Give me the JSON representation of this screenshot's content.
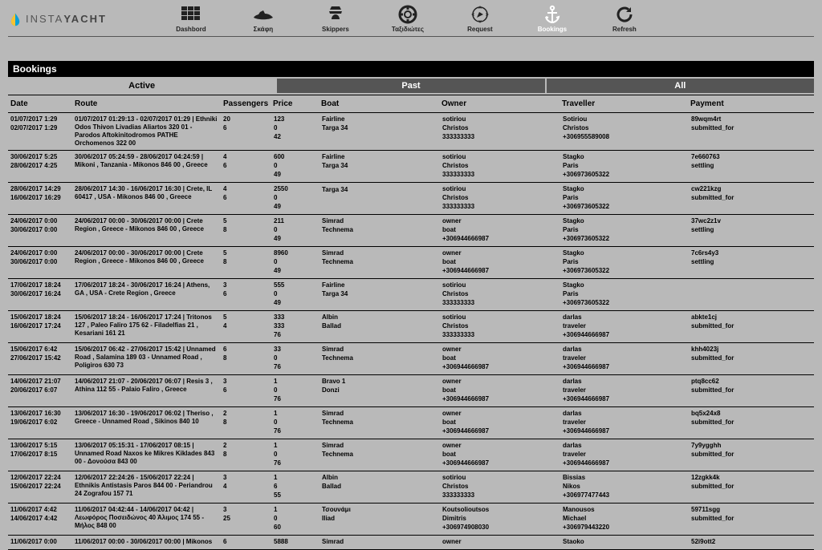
{
  "brand": {
    "name_a": "INSTA",
    "name_b": "YACHT"
  },
  "nav": {
    "dashboard": "Dashbord",
    "skafi": "Σκάφη",
    "skippers": "Skippers",
    "taxi": "Ταξιδιώτες",
    "request": "Request",
    "bookings": "Bookings",
    "refresh": "Refresh"
  },
  "title": "Bookings",
  "filters": {
    "active": "Active",
    "past": "Past",
    "all": "All"
  },
  "headers": {
    "date": "Date",
    "route": "Route",
    "passengers": "Passengers",
    "price": "Price",
    "boat": "Boat",
    "owner": "Owner",
    "traveller": "Traveller",
    "payment": "Payment"
  },
  "rows": [
    {
      "date": [
        "01/07/2017 1:29",
        "02/07/2017 1:29"
      ],
      "route": "01/07/2017 01:29:13 - 02/07/2017 01:29 |  Ethniki Odos Thivon Livadias Aliartos 320 01 - Parodos Aftokinitodromos PATHE Orchomenos 322 00",
      "pax": [
        "20",
        "6"
      ],
      "price": [
        "123",
        "0",
        "42"
      ],
      "boat": [
        "Fairline",
        "Targa 34",
        ""
      ],
      "owner": [
        "sotiriou",
        "Christos",
        "333333333"
      ],
      "trav": [
        "Sotiriou",
        "Christos",
        "+306955589008"
      ],
      "pay": [
        "89wqm4rt",
        "submitted_for",
        ""
      ]
    },
    {
      "date": [
        "30/06/2017 5:25",
        "28/06/2017 4:25"
      ],
      "route": "30/06/2017 05:24:59 - 28/06/2017 04:24:59 | Mikoni , Tanzania - Mikonos 846 00 , Greece",
      "pax": [
        "4",
        "6"
      ],
      "price": [
        "600",
        "0",
        "49"
      ],
      "boat": [
        "Fairline",
        "Targa 34",
        ""
      ],
      "owner": [
        "sotiriou",
        "Christos",
        "333333333"
      ],
      "trav": [
        "Stagko",
        "Paris",
        "+306973605322"
      ],
      "pay": [
        "7e660763",
        "settling",
        ""
      ]
    },
    {
      "date": [
        "28/06/2017 14:29",
        "16/06/2017 16:29"
      ],
      "route": "28/06/2017 14:30 - 16/06/2017 16:30 | Crete, IL 60417 , USA - Mikonos 846 00 , Greece",
      "pax": [
        "4",
        "6"
      ],
      "price": [
        "2550",
        "0",
        "49"
      ],
      "boat": [
        "",
        "Targa 34",
        ""
      ],
      "owner": [
        "sotiriou",
        "Christos",
        "333333333"
      ],
      "trav": [
        "Stagko",
        "Paris",
        "+306973605322"
      ],
      "pay": [
        "cw221kzg",
        "submitted_for",
        ""
      ]
    },
    {
      "date": [
        "24/06/2017 0:00",
        "30/06/2017 0:00"
      ],
      "route": "24/06/2017 00:00 - 30/06/2017 00:00 | Crete Region , Greece - Mikonos 846 00 , Greece",
      "pax": [
        "5",
        "8"
      ],
      "price": [
        "211",
        "0",
        "49"
      ],
      "boat": [
        "Simrad",
        "Technema",
        ""
      ],
      "owner": [
        "owner",
        "boat",
        "+306944666987"
      ],
      "trav": [
        "Stagko",
        "Paris",
        "+306973605322"
      ],
      "pay": [
        "37wc2z1v",
        "settling",
        ""
      ]
    },
    {
      "date": [
        "24/06/2017 0:00",
        "30/06/2017 0:00"
      ],
      "route": "24/06/2017 00:00 - 30/06/2017 00:00 | Crete Region , Greece - Mikonos 846 00 , Greece",
      "pax": [
        "5",
        "8"
      ],
      "price": [
        "8960",
        "0",
        "49"
      ],
      "boat": [
        "Simrad",
        "Technema",
        ""
      ],
      "owner": [
        "owner",
        "boat",
        "+306944666987"
      ],
      "trav": [
        "Stagko",
        "Paris",
        "+306973605322"
      ],
      "pay": [
        "7c6rs4y3",
        "settling",
        ""
      ]
    },
    {
      "date": [
        "17/06/2017 18:24",
        "30/06/2017 16:24"
      ],
      "route": "17/06/2017 18:24 - 30/06/2017 16:24 | Athens, GA , USA - Crete Region , Greece",
      "pax": [
        "3",
        "6"
      ],
      "price": [
        "555",
        "0",
        "49"
      ],
      "boat": [
        "Fairline",
        "Targa 34",
        ""
      ],
      "owner": [
        "sotiriou",
        "Christos",
        "333333333"
      ],
      "trav": [
        "Stagko",
        "Paris",
        "+306973605322"
      ],
      "pay": [
        "",
        "",
        ""
      ]
    },
    {
      "date": [
        "15/06/2017 18:24",
        "16/06/2017 17:24"
      ],
      "route": "15/06/2017 18:24 - 16/06/2017 17:24 | Tritonos 127 , Paleo Faliro 175 62 - Filadelfias 21 , Kesariani 161 21",
      "pax": [
        "5",
        "4"
      ],
      "price": [
        "333",
        "333",
        "76"
      ],
      "boat": [
        "Albin",
        "Ballad",
        ""
      ],
      "owner": [
        "sotiriou",
        "Christos",
        "333333333"
      ],
      "trav": [
        "darlas",
        "traveler",
        "+306944666987"
      ],
      "pay": [
        "abkte1cj",
        "submitted_for",
        ""
      ]
    },
    {
      "date": [
        "15/06/2017 6:42",
        "27/06/2017 15:42"
      ],
      "route": "15/06/2017 06:42 - 27/06/2017 15:42 | Unnamed Road , Salamina 189 03 - Unnamed Road , Poligiros 630 73",
      "pax": [
        "6",
        "8"
      ],
      "price": [
        "33",
        "0",
        "76"
      ],
      "boat": [
        "Simrad",
        "Technema",
        ""
      ],
      "owner": [
        "owner",
        "boat",
        "+306944666987"
      ],
      "trav": [
        "darlas",
        "traveler",
        "+306944666987"
      ],
      "pay": [
        "khh4023j",
        "submitted_for",
        ""
      ]
    },
    {
      "date": [
        "14/06/2017 21:07",
        "20/06/2017 6:07"
      ],
      "route": "14/06/2017 21:07 - 20/06/2017 06:07 | Resis 3 , Athina 112 55 - Palaio Faliro , Greece",
      "pax": [
        "3",
        "6"
      ],
      "price": [
        "1",
        "0",
        "76"
      ],
      "boat": [
        "Bravo 1",
        "Donzi",
        ""
      ],
      "owner": [
        "owner",
        "boat",
        "+306944666987"
      ],
      "trav": [
        "darlas",
        "traveler",
        "+306944666987"
      ],
      "pay": [
        "ptq8cc62",
        "submitted_for",
        ""
      ]
    },
    {
      "date": [
        "13/06/2017 16:30",
        "19/06/2017 6:02"
      ],
      "route": "13/06/2017 16:30 - 19/06/2017 06:02 | Theriso , Greece - Unnamed Road , Sikinos 840 10",
      "pax": [
        "2",
        "8"
      ],
      "price": [
        "1",
        "0",
        "76"
      ],
      "boat": [
        "Simrad",
        "Technema",
        ""
      ],
      "owner": [
        "owner",
        "boat",
        "+306944666987"
      ],
      "trav": [
        "darlas",
        "traveler",
        "+306944666987"
      ],
      "pay": [
        "bq5x24x8",
        "submitted_for",
        ""
      ]
    },
    {
      "date": [
        "13/06/2017 5:15",
        "17/06/2017 8:15"
      ],
      "route": "13/06/2017 05:15:31 - 17/06/2017 08:15 | Unnamed Road Naxos ke Mikres Kiklades 843 00 -  Δονούσα 843 00",
      "pax": [
        "2",
        "8"
      ],
      "price": [
        "1",
        "0",
        "76"
      ],
      "boat": [
        "Simrad",
        "Technema",
        ""
      ],
      "owner": [
        "owner",
        "boat",
        "+306944666987"
      ],
      "trav": [
        "darlas",
        "traveler",
        "+306944666987"
      ],
      "pay": [
        "7y9ygghh",
        "submitted_for",
        ""
      ]
    },
    {
      "date": [
        "12/06/2017 22:24",
        "15/06/2017 22:24"
      ],
      "route": "12/06/2017 22:24:26 - 15/06/2017 22:24 | Ethnikis Antistasis Paros 844 00 -  Periandrou 24 Zografou 157 71",
      "pax": [
        "3",
        "4"
      ],
      "price": [
        "1",
        "6",
        "55"
      ],
      "boat": [
        "Albin",
        "Ballad",
        ""
      ],
      "owner": [
        "sotiriou",
        "Christos",
        "333333333"
      ],
      "trav": [
        "Bissias",
        "Nikos",
        "+306977477443"
      ],
      "pay": [
        "12zgkk4k",
        "submitted_for",
        ""
      ]
    },
    {
      "date": [
        "11/06/2017 4:42",
        "14/06/2017 4:42"
      ],
      "route": "11/06/2017 04:42:44 - 14/06/2017 04:42 | Λεωφόρος Ποσειδώνος 40 Άλιμος 174 55 -  Μήλος 848 00",
      "pax": [
        "3",
        "25"
      ],
      "price": [
        "1",
        "0",
        "60"
      ],
      "boat": [
        "Τσουνάμι",
        "Iliad",
        ""
      ],
      "owner": [
        "Koutsolioutsos",
        "Dimitris",
        "+306974908030"
      ],
      "trav": [
        "Manousos",
        "Michael",
        "+306979443220"
      ],
      "pay": [
        "59711sgg",
        "submitted_for",
        ""
      ]
    },
    {
      "date": [
        "11/06/2017 0:00",
        ""
      ],
      "route": "11/06/2017 00:00 - 30/06/2017 00:00 | Mikonos",
      "pax": [
        "6",
        ""
      ],
      "price": [
        "5888",
        "",
        ""
      ],
      "boat": [
        "Simrad",
        "",
        ""
      ],
      "owner": [
        "owner",
        "",
        ""
      ],
      "trav": [
        "Staoko",
        "",
        ""
      ],
      "pay": [
        "52i9ott2",
        "",
        ""
      ]
    }
  ]
}
